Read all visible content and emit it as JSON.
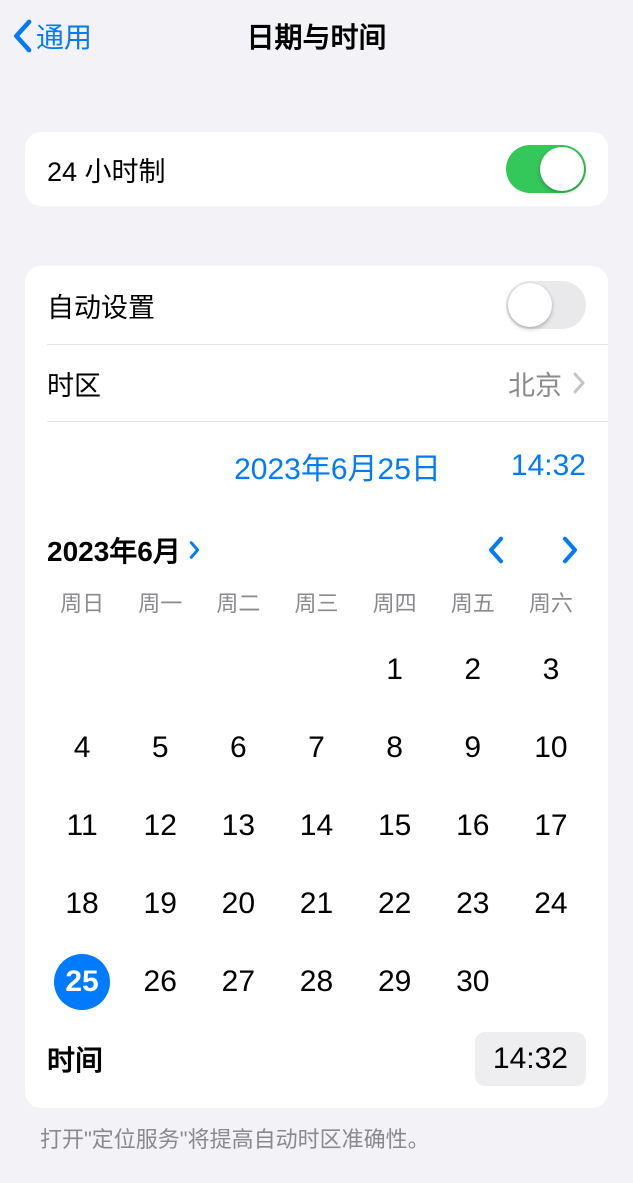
{
  "nav": {
    "back_label": "通用",
    "title": "日期与时间"
  },
  "settings": {
    "twenty_four_hour_label": "24 小时制",
    "twenty_four_hour_on": true,
    "auto_set_label": "自动设置",
    "auto_set_on": false,
    "timezone_label": "时区",
    "timezone_value": "北京"
  },
  "selected": {
    "date_display": "2023年6月25日",
    "time_display": "14:32"
  },
  "calendar": {
    "month_label": "2023年6月",
    "weekdays": [
      "周日",
      "周一",
      "周二",
      "周三",
      "周四",
      "周五",
      "周六"
    ],
    "leading_blanks": 4,
    "days": [
      1,
      2,
      3,
      4,
      5,
      6,
      7,
      8,
      9,
      10,
      11,
      12,
      13,
      14,
      15,
      16,
      17,
      18,
      19,
      20,
      21,
      22,
      23,
      24,
      25,
      26,
      27,
      28,
      29,
      30
    ],
    "selected_day": 25
  },
  "time_row": {
    "label": "时间",
    "value": "14:32"
  },
  "footer_note": "打开\"定位服务\"将提高自动时区准确性。"
}
